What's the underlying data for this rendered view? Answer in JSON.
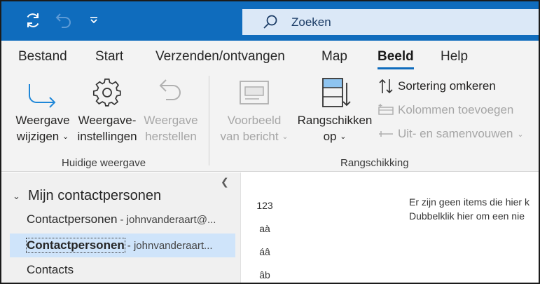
{
  "quick_access": {
    "sync_icon": "sync-icon",
    "undo_icon": "undo-icon",
    "customize_icon": "customize-dropdown-icon"
  },
  "search": {
    "placeholder": "Zoeken"
  },
  "tabs": [
    {
      "label": "Bestand"
    },
    {
      "label": "Start"
    },
    {
      "label": "Verzenden/ontvangen"
    },
    {
      "label": "Map"
    },
    {
      "label": "Beeld",
      "active": true
    },
    {
      "label": "Help"
    }
  ],
  "ribbon": {
    "current_view": {
      "group_label": "Huidige weergave",
      "change_view": {
        "line1": "Weergave",
        "line2": "wijzigen"
      },
      "view_settings": {
        "line1": "Weergave-",
        "line2": "instellingen"
      },
      "reset_view": {
        "line1": "Weergave",
        "line2": "herstellen"
      }
    },
    "arrangement": {
      "group_label": "Rangschikking",
      "preview": {
        "line1": "Voorbeeld",
        "line2": "van bericht"
      },
      "arrange_by": {
        "line1": "Rangschikken",
        "line2": "op"
      },
      "reverse_sort": "Sortering omkeren",
      "add_columns": "Kolommen toevoegen",
      "expand_collapse": "Uit- en samenvouwen"
    }
  },
  "nav": {
    "header": "Mijn contactpersonen",
    "items": [
      {
        "name": "Contactpersonen",
        "account": "- johnvanderaart@..."
      },
      {
        "name": "Contactpersonen",
        "account": "- johnvanderaart...",
        "selected": true
      },
      {
        "name": "Contacts",
        "account": ""
      }
    ]
  },
  "main": {
    "index_letters": [
      "123",
      "aà",
      "áâ",
      "âb"
    ],
    "empty_line1": "Er zijn geen items die hier k",
    "empty_line2": "Dubbelklik hier om een nie"
  },
  "colors": {
    "titlebar": "#0f6cbd",
    "search_bg": "#dbe8f7",
    "ribbon_bg": "#f3f3f3",
    "selected_bg": "#cfe4fa",
    "accent": "#0f6cbd"
  }
}
